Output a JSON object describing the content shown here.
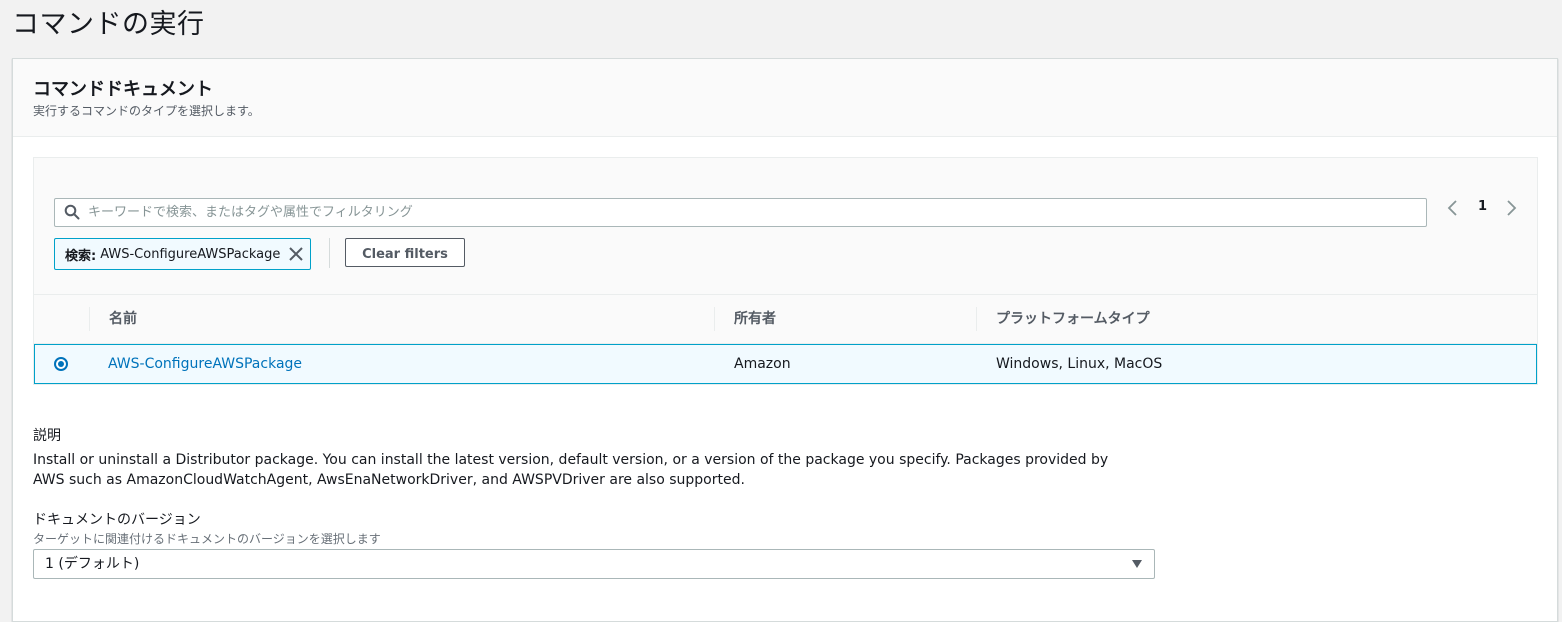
{
  "page": {
    "title": "コマンドの実行"
  },
  "panel": {
    "title": "コマンドドキュメント",
    "subtitle": "実行するコマンドのタイプを選択します。"
  },
  "filter": {
    "placeholder": "キーワードで検索、またはタグや属性でフィルタリング",
    "token_key": "検索:",
    "token_value": "AWS-ConfigureAWSPackage",
    "clear_label": "Clear filters"
  },
  "pagination": {
    "current_page": "1"
  },
  "table": {
    "columns": [
      "名前",
      "所有者",
      "プラットフォームタイプ"
    ],
    "rows": [
      {
        "name": "AWS-ConfigureAWSPackage",
        "owner": "Amazon",
        "platform": "Windows, Linux, MacOS",
        "selected": true
      }
    ]
  },
  "description": {
    "label": "説明",
    "text": "Install or uninstall a Distributor package. You can install the latest version, default version, or a version of the package you specify. Packages provided by AWS such as AmazonCloudWatchAgent, AwsEnaNetworkDriver, and AWSPVDriver are also supported."
  },
  "version": {
    "label": "ドキュメントのバージョン",
    "hint": "ターゲットに関連付けるドキュメントのバージョンを選択します",
    "selected": "1 (デフォルト)"
  },
  "colors": {
    "accent": "#0073bb",
    "selected_border": "#00a1c9",
    "selected_bg": "#f1faff"
  }
}
